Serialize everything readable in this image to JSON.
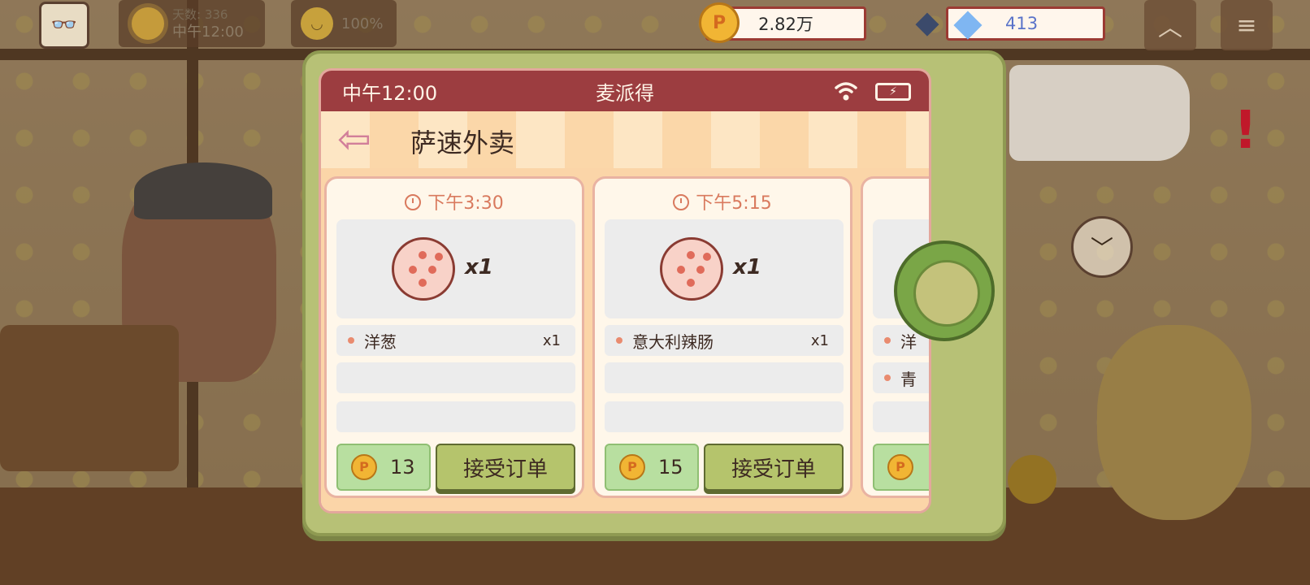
{
  "hud": {
    "avatar_icon": "avatar-glasses-icon",
    "day_label": "天数: 336",
    "day_time": "中午12:00",
    "mood_percent": "100%",
    "coins": "2.82万",
    "gems": "413"
  },
  "phone": {
    "status_time": "中午12:00",
    "app_name": "麦派得",
    "title": "萨速外卖",
    "battery_symbol": "⚡"
  },
  "orders": [
    {
      "time": "下午3:30",
      "pizza_qty": "x1",
      "toppings": [
        {
          "name": "洋葱",
          "count": "x1"
        }
      ],
      "reward": "13",
      "accept_label": "接受订单"
    },
    {
      "time": "下午5:15",
      "pizza_qty": "x1",
      "toppings": [
        {
          "name": "意大利辣肠",
          "count": "x1"
        }
      ],
      "reward": "15",
      "accept_label": "接受订单"
    },
    {
      "partial_topping_1": "洋",
      "partial_topping_2": "青"
    }
  ],
  "colors": {
    "status_bar": "#9c3d40",
    "accept_button": "#b5c46c",
    "reward_bg": "#b8dfa0",
    "phone_frame": "#b7c176"
  }
}
